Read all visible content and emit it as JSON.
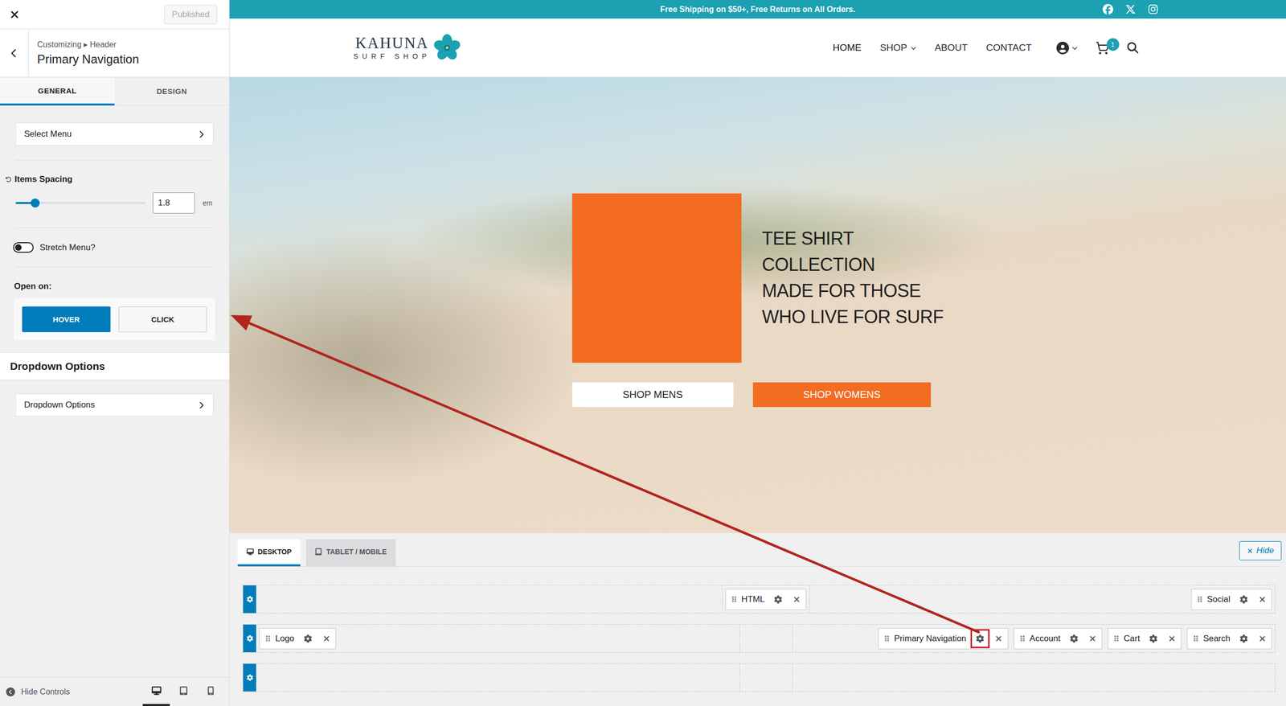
{
  "customizer": {
    "publish_button": {
      "label": "Published",
      "disabled": true
    },
    "breadcrumb": "Customizing ▸ Header",
    "title": "Primary Navigation",
    "tabs": [
      {
        "label": "GENERAL",
        "selected": true
      },
      {
        "label": "DESIGN",
        "selected": false
      }
    ],
    "controls": [
      {
        "kind": "link",
        "label": "Select Menu"
      },
      {
        "kind": "slider",
        "label": "Items Spacing",
        "level": 0.15,
        "value": "1.8",
        "unit": "em"
      },
      {
        "kind": "toggle",
        "label": "Stretch Menu?",
        "on": false
      },
      {
        "kind": "choice",
        "label": "Open on:",
        "options": [
          {
            "label": "HOVER",
            "selected": true
          },
          {
            "label": "CLICK",
            "selected": false
          }
        ]
      }
    ],
    "sections": [
      {
        "title": "Dropdown Options",
        "link": "Dropdown Options"
      }
    ],
    "footer": {
      "label": "Hide Controls",
      "devices": [
        {
          "kind": "desktop",
          "selected": true
        },
        {
          "kind": "tablet",
          "selected": false
        },
        {
          "kind": "mobile",
          "selected": false
        }
      ]
    }
  },
  "preview": {
    "topbar": {
      "text": "Free Shipping on $50+, Free Returns on All Orders.",
      "social": [
        {
          "kind": "facebook"
        },
        {
          "kind": "x"
        },
        {
          "kind": "instagram"
        }
      ]
    },
    "logo": {
      "name": "KAHUNA",
      "tagline": "SURF SHOP"
    },
    "nav": [
      {
        "label": "HOME",
        "selected": true,
        "dropdown": false
      },
      {
        "label": "SHOP",
        "selected": false,
        "dropdown": true
      },
      {
        "label": "ABOUT",
        "selected": false,
        "dropdown": false
      },
      {
        "label": "CONTACT",
        "selected": false,
        "dropdown": false
      }
    ],
    "header_icons": [
      {
        "kind": "account",
        "dropdown": true,
        "badge": ""
      },
      {
        "kind": "cart",
        "dropdown": false,
        "badge": "1"
      },
      {
        "kind": "search",
        "dropdown": false,
        "badge": ""
      }
    ],
    "hero": {
      "heading": [
        "TEE SHIRT",
        "COLLECTION",
        "MADE FOR THOSE",
        "WHO LIVE FOR SURF"
      ],
      "buttons": [
        {
          "label": "SHOP MENS",
          "kind": "light"
        },
        {
          "label": "SHOP WOMENS",
          "kind": "accent"
        }
      ]
    }
  },
  "builder": {
    "tabs": [
      {
        "label": "DESKTOP",
        "kind": "desktop",
        "selected": true
      },
      {
        "label": "TABLET / MOBILE",
        "kind": "tablet",
        "selected": false
      }
    ],
    "hide": "Hide",
    "rows": [
      {
        "left": [],
        "center": [
          {
            "label": "HTML",
            "highlighted": false
          }
        ],
        "right": [
          {
            "label": "Social",
            "highlighted": false
          }
        ]
      },
      {
        "left": [
          {
            "label": "Logo",
            "highlighted": false
          }
        ],
        "center": [],
        "right": [
          {
            "label": "Primary Navigation",
            "highlighted": true
          },
          {
            "label": "Account",
            "highlighted": false
          },
          {
            "label": "Cart",
            "highlighted": false
          },
          {
            "label": "Search",
            "highlighted": false
          }
        ]
      },
      {
        "left": [],
        "center": [],
        "right": []
      }
    ]
  }
}
